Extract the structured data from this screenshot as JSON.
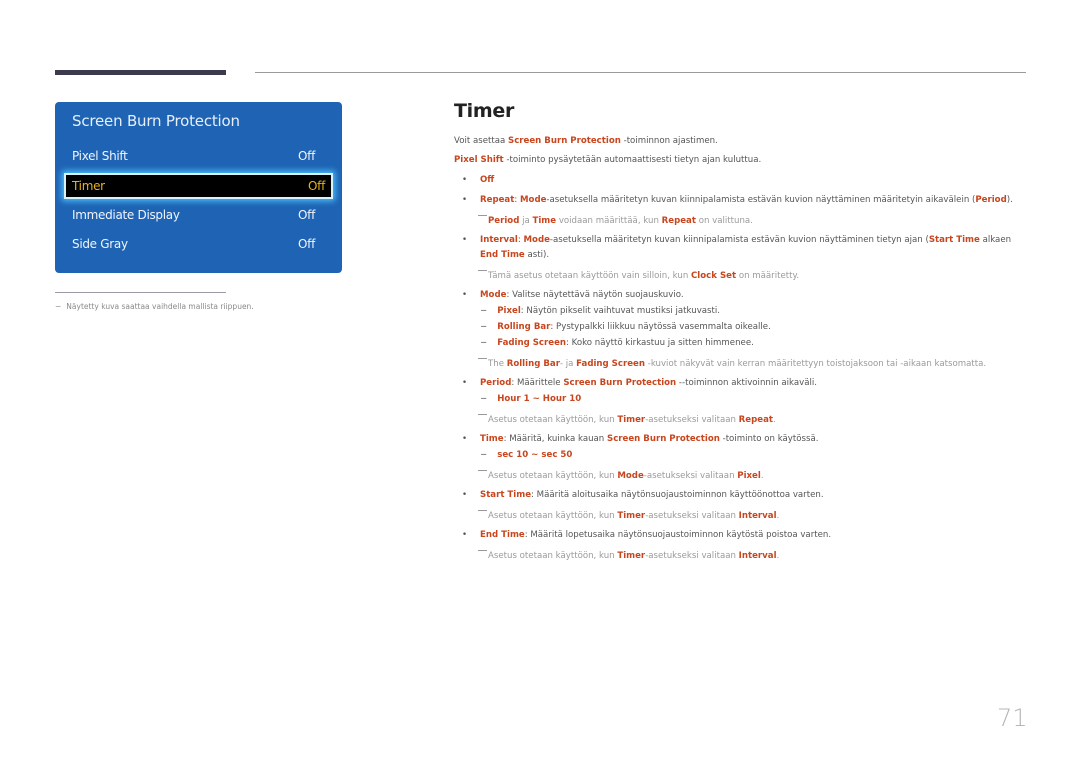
{
  "osd": {
    "title": "Screen Burn Protection",
    "items": [
      {
        "label": "Pixel Shift",
        "value": "Off"
      },
      {
        "label": "Timer",
        "value": "Off",
        "selected": true
      },
      {
        "label": "Immediate Display",
        "value": "Off"
      },
      {
        "label": "Side Gray",
        "value": "Off"
      }
    ]
  },
  "footnote": {
    "dash": "−",
    "text": "Näytetty kuva saattaa vaihdella mallista riippuen."
  },
  "heading": "Timer",
  "intro": {
    "l1_a": "Voit asettaa ",
    "l1_b": "Screen Burn Protection",
    "l1_c": " -toiminnon ajastimen.",
    "l2_a": "Pixel Shift",
    "l2_b": " -toiminto pysäytetään automaattisesti tietyn ajan kuluttua."
  },
  "bullets": {
    "off": "Off",
    "repeat": {
      "a": "Repeat",
      "b": ": ",
      "c": "Mode",
      "d": "-asetuksella määritetyn kuvan kiinnipalamista estävän kuvion näyttäminen määritetyin aikavälein (",
      "e": "Period",
      "f": ")."
    },
    "repeat_note": {
      "a": "Period",
      "b": " ja ",
      "c": "Time",
      "d": " voidaan määrittää, kun ",
      "e": "Repeat",
      "f": " on valittuna."
    },
    "interval": {
      "a": "Interval",
      "b": ": ",
      "c": "Mode",
      "d": "-asetuksella määritetyn kuvan kiinnipalamista estävän kuvion näyttäminen tietyn ajan (",
      "e": "Start Time",
      "f": " alkaen",
      "g": "End Time",
      "h": " asti)."
    },
    "interval_note": {
      "a": "Tämä asetus otetaan käyttöön vain silloin, kun ",
      "b": "Clock Set",
      "c": " on määritetty."
    },
    "mode": {
      "a": "Mode",
      "b": ": Valitse näytettävä näytön suojauskuvio."
    },
    "mode_subs": [
      {
        "a": "Pixel",
        "b": ": Näytön pikselit vaihtuvat mustiksi jatkuvasti."
      },
      {
        "a": "Rolling Bar",
        "b": ": Pystypalkki liikkuu näytössä vasemmalta oikealle."
      },
      {
        "a": "Fading Screen",
        "b": ": Koko näyttö kirkastuu ja sitten himmenee."
      }
    ],
    "mode_note": {
      "a": "The ",
      "b": "Rolling Bar",
      "c": "- ja ",
      "d": "Fading Screen",
      "e": " -kuviot näkyvät vain kerran määritettyyn toistojaksoon tai -aikaan katsomatta."
    },
    "period": {
      "a": "Period",
      "b": ": Määrittele ",
      "c": "Screen Burn Protection",
      "d": " --toiminnon aktivoinnin aikaväli."
    },
    "period_range": "Hour 1 ~ Hour 10",
    "period_note": {
      "a": "Asetus otetaan käyttöön, kun ",
      "b": "Timer",
      "c": "-asetukseksi valitaan ",
      "d": "Repeat",
      "e": "."
    },
    "time": {
      "a": "Time",
      "b": ": Määritä, kuinka kauan ",
      "c": "Screen Burn Protection",
      "d": " -toiminto on käytössä."
    },
    "time_range": "sec 10 ~ sec 50",
    "time_note": {
      "a": "Asetus otetaan käyttöön, kun ",
      "b": "Mode",
      "c": "-asetukseksi valitaan ",
      "d": "Pixel",
      "e": "."
    },
    "start": {
      "a": "Start Time",
      "b": ": Määritä aloitusaika näytönsuojaustoiminnon käyttöönottoa varten."
    },
    "start_note": {
      "a": "Asetus otetaan käyttöön, kun ",
      "b": "Timer",
      "c": "-asetukseksi valitaan ",
      "d": "Interval",
      "e": "."
    },
    "end": {
      "a": "End Time",
      "b": ": Määritä lopetusaika näytönsuojaustoiminnon käytöstä poistoa varten."
    },
    "end_note": {
      "a": "Asetus otetaan käyttöön, kun ",
      "b": "Timer",
      "c": "-asetukseksi valitaan ",
      "d": "Interval",
      "e": "."
    }
  },
  "symbols": {
    "bullet": "•",
    "dash": "−"
  },
  "page_number": "71"
}
